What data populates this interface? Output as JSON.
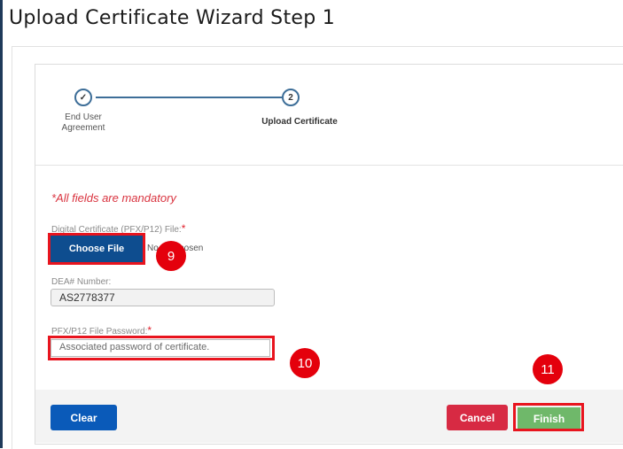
{
  "page": {
    "title": "Upload Certificate Wizard Step 1"
  },
  "stepper": {
    "steps": [
      {
        "number": "✓",
        "label": "End User Agreement",
        "state": "completed"
      },
      {
        "number": "2",
        "label": "Upload Certificate",
        "state": "active"
      }
    ]
  },
  "form": {
    "mandatory_note": "*All fields are mandatory",
    "certificate_file": {
      "label": "Digital Certificate (PFX/P12) File:",
      "required_mark": "*",
      "button_label": "Choose File",
      "status_text": "No file chosen"
    },
    "dea_number": {
      "label": "DEA# Number:",
      "value": "AS2778377"
    },
    "password": {
      "label": "PFX/P12 File Password:",
      "required_mark": "*",
      "placeholder": "Associated password of certificate."
    }
  },
  "footer": {
    "clear_label": "Clear",
    "cancel_label": "Cancel",
    "finish_label": "Finish"
  },
  "annotations": [
    {
      "number": "9"
    },
    {
      "number": "10"
    },
    {
      "number": "11"
    }
  ],
  "colors": {
    "primary": "#0e4d8f",
    "clear": "#0a5ab9",
    "cancel": "#d72a43",
    "finish": "#6fb86a",
    "highlight": "#e8141e",
    "stepper": "#3d6e98"
  }
}
